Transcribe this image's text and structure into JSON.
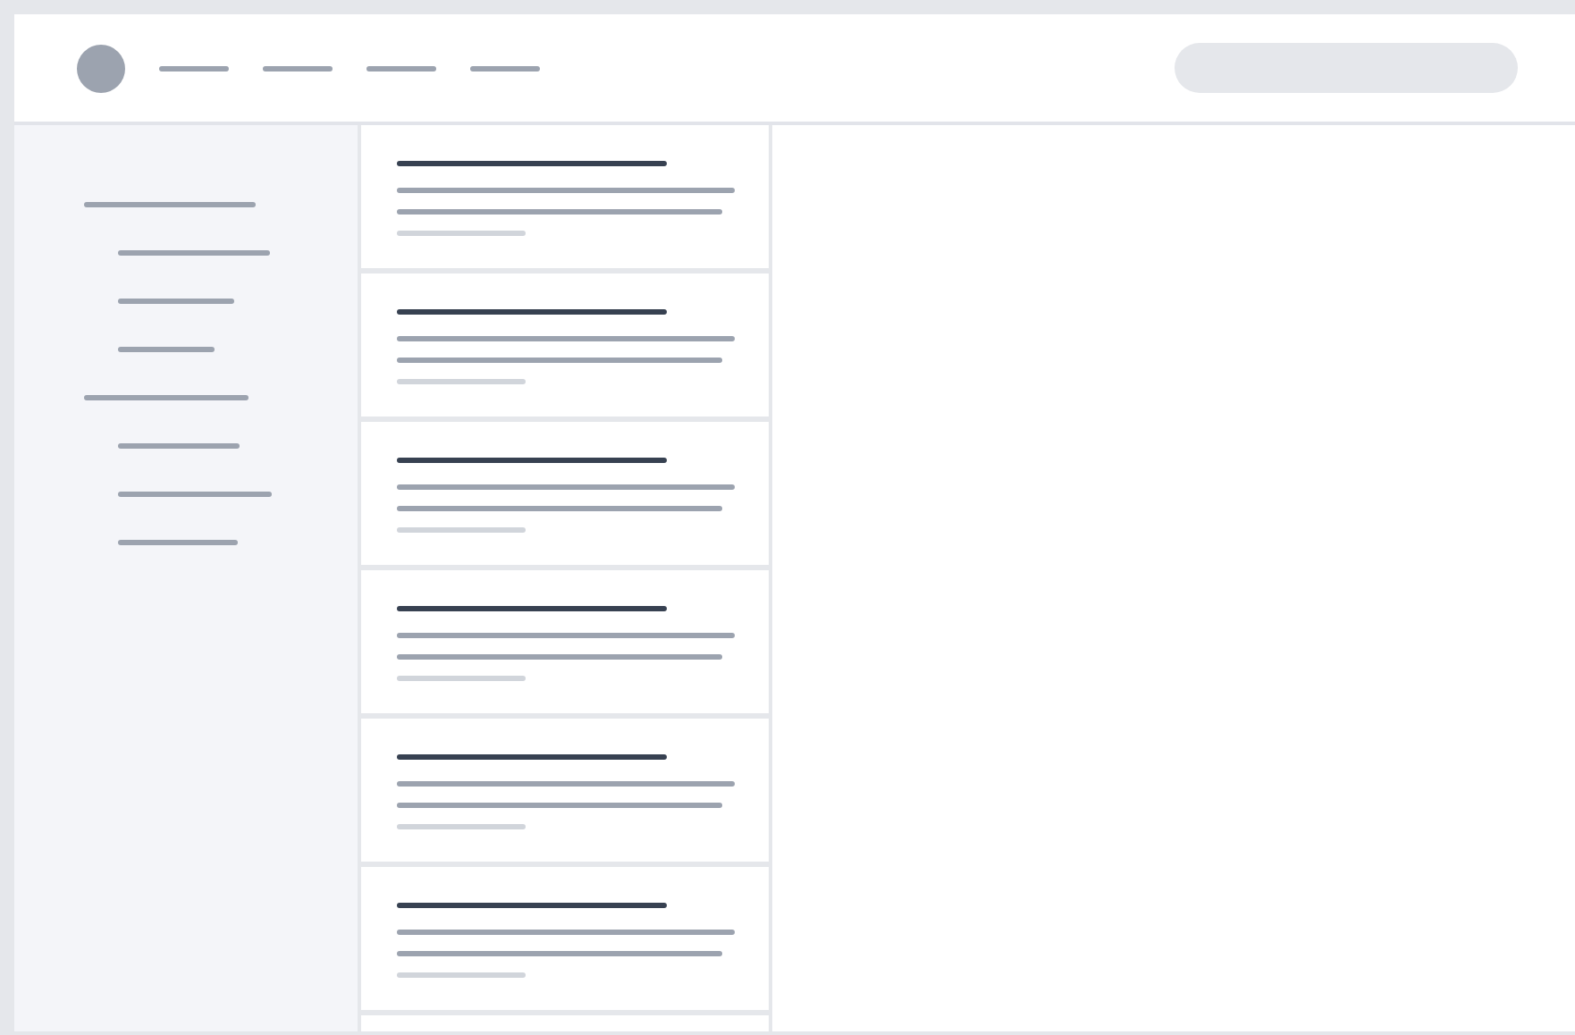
{
  "header": {
    "avatar": {
      "kind": "circle"
    },
    "nav_links": [
      {
        "kind": "link"
      },
      {
        "kind": "link"
      },
      {
        "kind": "link"
      },
      {
        "kind": "link"
      }
    ],
    "search": {
      "kind": "pill"
    }
  },
  "sidebar": {
    "groups": [
      {
        "kind": "heading",
        "children": [
          {
            "kind": "link"
          },
          {
            "kind": "link"
          },
          {
            "kind": "link"
          }
        ]
      },
      {
        "kind": "heading",
        "children": [
          {
            "kind": "link"
          },
          {
            "kind": "link"
          },
          {
            "kind": "link"
          }
        ]
      }
    ]
  },
  "list": {
    "items": [
      {
        "kind": "card"
      },
      {
        "kind": "card"
      },
      {
        "kind": "card"
      },
      {
        "kind": "card"
      },
      {
        "kind": "card"
      },
      {
        "kind": "card"
      },
      {
        "kind": "card"
      }
    ]
  }
}
